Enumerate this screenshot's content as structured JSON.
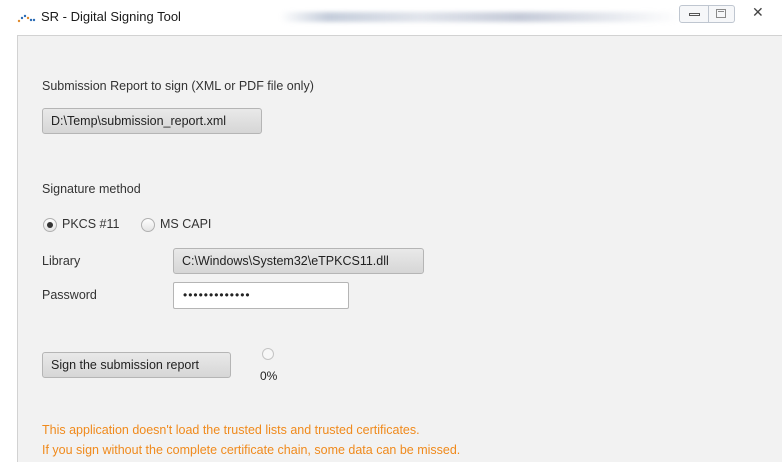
{
  "window": {
    "title": "SR - Digital Signing Tool"
  },
  "report_section": {
    "label": "Submission Report to sign (XML or PDF file only)",
    "file_button": "D:\\Temp\\submission_report.xml"
  },
  "signature": {
    "label": "Signature method",
    "options": [
      {
        "label": "PKCS #11",
        "selected": true
      },
      {
        "label": "MS CAPI",
        "selected": false
      }
    ],
    "library_label": "Library",
    "library_button": "C:\\Windows\\System32\\eTPKCS11.dll",
    "password_label": "Password",
    "password_value": "•••••••••••••"
  },
  "actions": {
    "sign_button": "Sign the submission report",
    "progress_text": "0%"
  },
  "warnings": {
    "line1": "This application doesn't load the trusted lists and trusted certificates.",
    "line2": "If you sign without the complete certificate chain, some data can be missed."
  },
  "colors": {
    "warning": "#f08a1c",
    "panel": "#f2f2f2"
  }
}
